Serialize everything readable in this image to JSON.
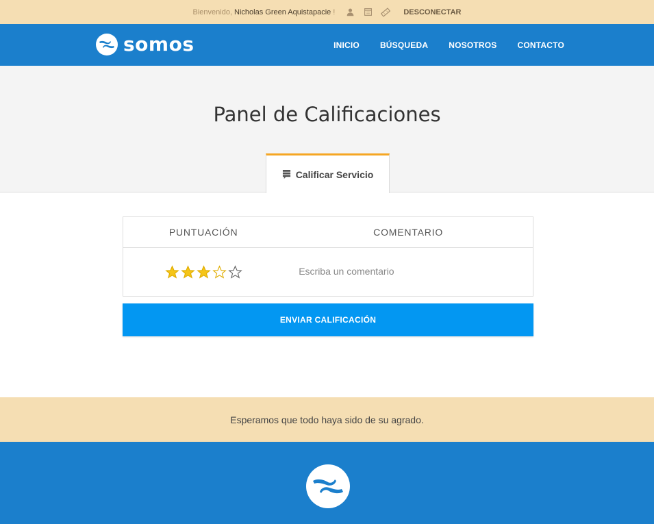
{
  "topbar": {
    "welcome": "Bienvenido,",
    "username": "Nicholas Green Aquistapacie",
    "exclaim": "!",
    "icons": [
      "user-icon",
      "calendar-icon",
      "ticket-icon"
    ],
    "logout_label": "DESCONECTAR"
  },
  "header": {
    "brand": "somos",
    "nav": [
      "INICIO",
      "BÚSQUEDA",
      "NOSOTROS",
      "CONTACTO"
    ]
  },
  "hero": {
    "title": "Panel de Calificaciones",
    "tab_label": "Calificar Servicio",
    "tab_icon": "comment-list-icon"
  },
  "ratings": {
    "col_score": "PUNTUACIÓN",
    "col_comment": "COMENTARIO",
    "rating": 3,
    "max_rating": 5,
    "comment_value": "",
    "comment_placeholder": "Escriba un comentario",
    "submit_label": "ENVIAR CALIFICACIÓN"
  },
  "message": "Esperamos que todo haya sido de su agrado.",
  "colors": {
    "topbar_bg": "#f5deb3",
    "brand_blue": "#1b7fcc",
    "button_blue": "#0397f2",
    "tab_accent": "#f5a623",
    "star_filled": "#f5c518"
  }
}
